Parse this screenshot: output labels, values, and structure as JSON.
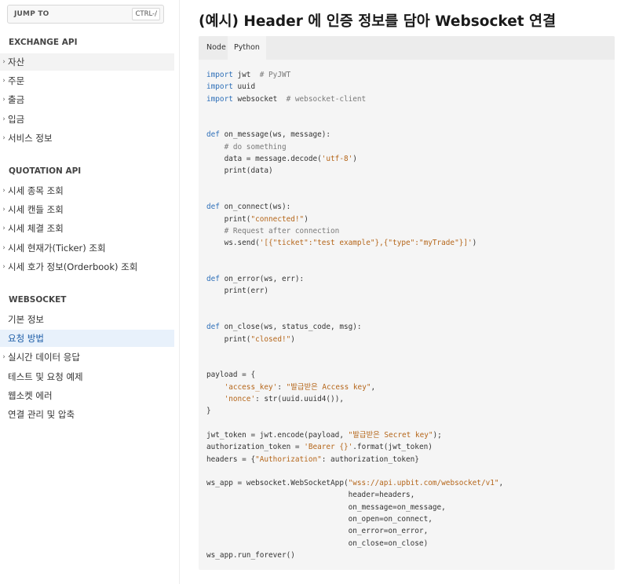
{
  "sidebar": {
    "jump_label": "JUMP TO",
    "jump_shortcut": "CTRL-/",
    "sections": [
      {
        "title": "EXCHANGE API",
        "items": [
          {
            "label": "자산",
            "expandable": true
          },
          {
            "label": "주문",
            "expandable": true
          },
          {
            "label": "출금",
            "expandable": true
          },
          {
            "label": "입금",
            "expandable": true
          },
          {
            "label": "서비스 정보",
            "expandable": true
          }
        ]
      },
      {
        "title": "QUOTATION API",
        "items": [
          {
            "label": "시세 종목 조회",
            "expandable": true
          },
          {
            "label": "시세 캔들 조회",
            "expandable": true
          },
          {
            "label": "시세 체결 조회",
            "expandable": true
          },
          {
            "label": "시세 현재가(Ticker) 조회",
            "expandable": true
          },
          {
            "label": "시세 호가 정보(Orderbook) 조회",
            "expandable": true
          }
        ]
      },
      {
        "title": "WEBSOCKET",
        "items": [
          {
            "label": "기본 정보",
            "expandable": false
          },
          {
            "label": "요청 방법",
            "expandable": false,
            "active": true
          },
          {
            "label": "실시간 데이터 응답",
            "expandable": true
          },
          {
            "label": "테스트 및 요청 예제",
            "expandable": false
          },
          {
            "label": "웹소켓 에러",
            "expandable": false
          },
          {
            "label": "연결 관리 및 압축",
            "expandable": false
          }
        ]
      }
    ]
  },
  "main": {
    "title": "(예시) Header 에 인증 정보를 담아 Websocket 연결",
    "tabs": [
      "Node",
      "Python"
    ],
    "selected_tab": "Python",
    "code_lines": [
      "import jwt  # PyJWT",
      "import uuid",
      "import websocket  # websocket-client",
      "",
      "",
      "def on_message(ws, message):",
      "    # do something",
      "    data = message.decode('utf-8')",
      "    print(data)",
      "",
      "",
      "def on_connect(ws):",
      "    print(\"connected!\")",
      "    # Request after connection",
      "    ws.send('[{\"ticket\":\"test example\"},{\"type\":\"myTrade\"}]')",
      "",
      "",
      "def on_error(ws, err):",
      "    print(err)",
      "",
      "",
      "def on_close(ws, status_code, msg):",
      "    print(\"closed!\")",
      "",
      "",
      "payload = {",
      "    'access_key': \"발급받은 Access key\",",
      "    'nonce': str(uuid.uuid4()),",
      "}",
      "",
      "jwt_token = jwt.encode(payload, \"발급받은 Secret key\");",
      "authorization_token = 'Bearer {}'.format(jwt_token)",
      "headers = {\"Authorization\": authorization_token}",
      "",
      "ws_app = websocket.WebSocketApp(\"wss://api.upbit.com/websocket/v1\",",
      "                                header=headers,",
      "                                on_message=on_message,",
      "                                on_open=on_connect,",
      "                                on_error=on_error,",
      "                                on_close=on_close)",
      "ws_app.run_forever()"
    ]
  },
  "colors": {
    "keyword": "#2e6fb8",
    "comment": "#7a7a7a",
    "string": "#b5661a",
    "active_bg": "#e8f1fb",
    "active_text": "#1f5fa8"
  }
}
